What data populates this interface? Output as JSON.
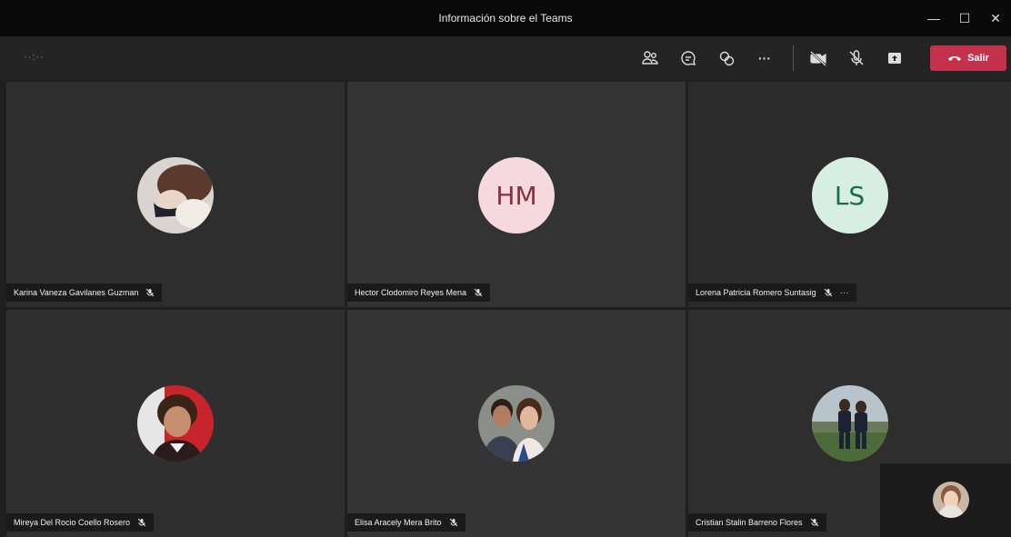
{
  "window": {
    "title": "Información sobre el Teams",
    "minimize": "—",
    "maximize": "☐",
    "close": "✕"
  },
  "toolbar": {
    "timer": "··:··",
    "icons": [
      "participants-icon",
      "chat-icon",
      "reactions-icon",
      "more-icon",
      "camera-off-icon",
      "mic-off-icon",
      "share-icon"
    ],
    "more_label": "···",
    "leave_label": "Salir",
    "leave_color": "#c4314b"
  },
  "participants": [
    {
      "name": "Karina Vaneza Gavilanes Guzman",
      "avatar": "photo"
    },
    {
      "name": "Hector Clodomiro Reyes Mena",
      "avatar": "initials",
      "initials": "HM"
    },
    {
      "name": "Lorena Patricia Romero Suntasig",
      "avatar": "initials",
      "initials": "LS",
      "more": "···"
    },
    {
      "name": "Mireya Del Rocio Coello Rosero",
      "avatar": "photo"
    },
    {
      "name": "Elisa Aracely Mera Brito",
      "avatar": "photo"
    },
    {
      "name": "Cristian Stalin Barreno Flores",
      "avatar": "photo"
    }
  ]
}
